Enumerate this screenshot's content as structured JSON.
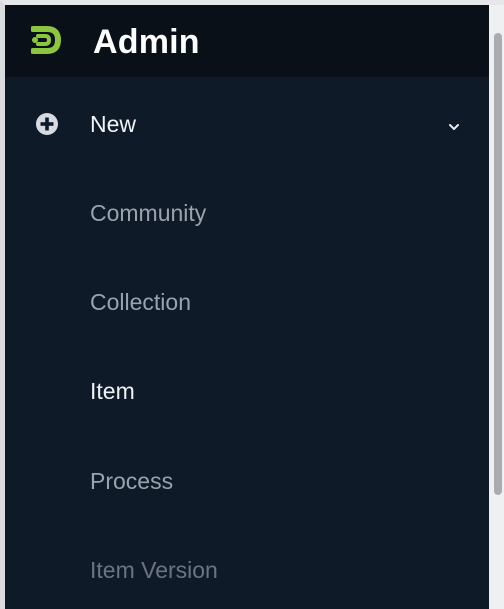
{
  "app": {
    "title": "Admin",
    "logo_icon": "dspace-logo-icon",
    "accent_color": "#8cc63f"
  },
  "nav": {
    "new_section": {
      "label": "New",
      "icon": "plus-circle-icon",
      "toggle_icon": "chevron-down-icon",
      "expanded": true
    },
    "children": [
      {
        "label": "Community"
      },
      {
        "label": "Collection"
      },
      {
        "label": "Item"
      },
      {
        "label": "Process"
      },
      {
        "label": "Item Version"
      }
    ]
  }
}
